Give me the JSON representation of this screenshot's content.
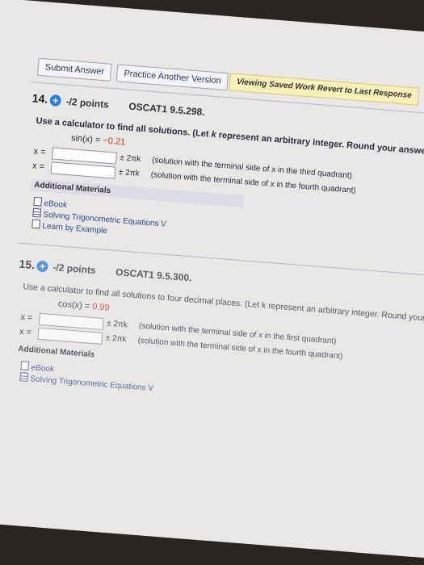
{
  "toolbar": {
    "submit_label": "Submit Answer",
    "practice_label": "Practice Another Version",
    "notice": "Viewing Saved Work Revert to Last Response"
  },
  "q14": {
    "number": "14.",
    "points": "-/2 points",
    "code": "OSCAT1 9.5.298.",
    "instruction_pre": "Use a calculator to find all solutions. (Let ",
    "instruction_k": "k",
    "instruction_post": " represent an arbitrary integer. Round your answers to four decimal places.)",
    "equation_lhs": "sin(x) = ",
    "equation_value": "−0.21",
    "rows": [
      {
        "var": "x =",
        "pm": "± 2πk",
        "note": "(solution with the terminal side of x in the third quadrant)"
      },
      {
        "var": "x =",
        "pm": "± 2πk",
        "note": "(solution with the terminal side of x in the fourth quadrant)"
      }
    ],
    "additional": "Additional Materials",
    "resources": [
      "eBook",
      "Solving Trigonometric Equations V",
      "Learn by Example"
    ]
  },
  "q15": {
    "number": "15.",
    "points": "-/2 points",
    "code": "OSCAT1 9.5.300.",
    "instruction": "Use a calculator to find all solutions to four decimal places. (Let k represent an arbitrary integer. Round your answers to four decim",
    "equation_lhs": "cos(x) = ",
    "equation_value": "0.99",
    "rows": [
      {
        "var": "x =",
        "pm": "± 2πk",
        "note": "(solution with the terminal side of x in the first quadrant)"
      },
      {
        "var": "x =",
        "pm": "± 2πk",
        "note": "(solution with the terminal side of x in the fourth quadrant)"
      }
    ],
    "additional": "Additional Materials",
    "resources": [
      "eBook",
      "Solving Trigonometric Equations V"
    ]
  },
  "colors": {
    "accent": "#2f7fd6",
    "value_red": "#c0392b",
    "notice_bg": "#f7f0b8"
  },
  "icons": [
    "plus-circle-icon",
    "document-icon",
    "table-icon"
  ]
}
